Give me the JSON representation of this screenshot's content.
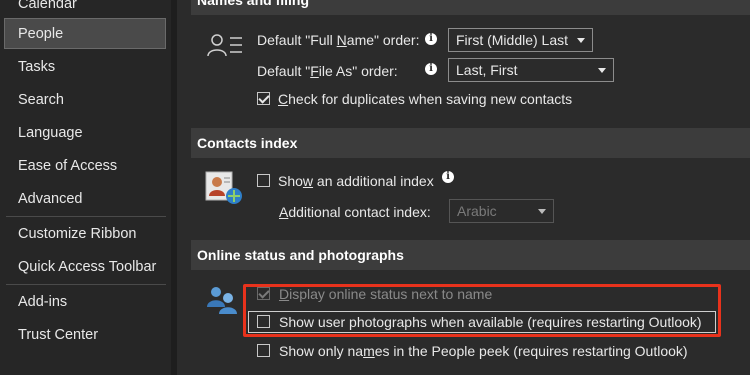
{
  "sidebar": {
    "items": [
      {
        "label": "Calendar",
        "selected": false
      },
      {
        "label": "People",
        "selected": true
      },
      {
        "label": "Tasks",
        "selected": false
      },
      {
        "label": "Search",
        "selected": false
      },
      {
        "label": "Language",
        "selected": false
      },
      {
        "label": "Ease of Access",
        "selected": false
      },
      {
        "label": "Advanced",
        "selected": false
      },
      {
        "label": "Customize Ribbon",
        "selected": false
      },
      {
        "label": "Quick Access Toolbar",
        "selected": false
      },
      {
        "label": "Add-ins",
        "selected": false
      },
      {
        "label": "Trust Center",
        "selected": false
      }
    ]
  },
  "names_filing": {
    "header": "Names and filing",
    "full_name_label_pre": "Default \"Full ",
    "full_name_label_ul": "N",
    "full_name_label_post": "ame\" order:",
    "full_name_value": "First (Middle) Last",
    "file_as_label_pre": "Default \"",
    "file_as_label_ul": "F",
    "file_as_label_post": "ile As\" order:",
    "file_as_value": "Last, First",
    "duplicates_ul": "C",
    "duplicates_label": "heck for duplicates when saving new contacts",
    "duplicates_checked": true
  },
  "contacts_index": {
    "header": "Contacts index",
    "show_index_pre": "Sho",
    "show_index_ul": "w",
    "show_index_post": " an additional index",
    "show_index_checked": false,
    "additional_label_ul": "A",
    "additional_label": "dditional contact index:",
    "additional_value": "Arabic"
  },
  "online_status": {
    "header": "Online status and photographs",
    "display_online_ul": "D",
    "display_online_label": "isplay online status next to name",
    "display_online_checked": true,
    "show_photos_label": "Show user photographs when available (requires restarting Outlook)",
    "show_photos_checked": false,
    "show_names_pre": "Show only na",
    "show_names_ul": "m",
    "show_names_post": "es in the People peek (requires restarting Outlook)",
    "show_names_checked": false
  },
  "colors": {
    "highlight": "#e8321c",
    "background": "#2b2b2b",
    "section_header": "#3c3c3c"
  }
}
